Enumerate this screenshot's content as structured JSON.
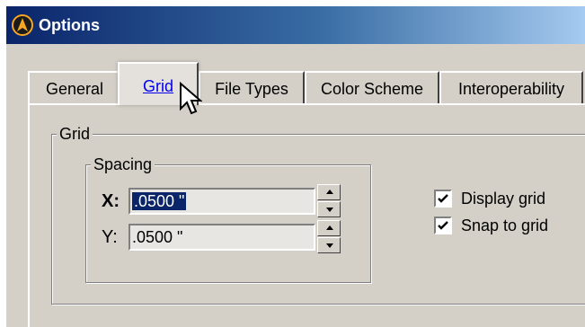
{
  "window": {
    "title": "Options"
  },
  "tabs": [
    {
      "label": "General"
    },
    {
      "label": "Grid"
    },
    {
      "label": "File Types"
    },
    {
      "label": "Color Scheme"
    },
    {
      "label": "Interoperability"
    }
  ],
  "grid_group": {
    "label": "Grid",
    "spacing_group": {
      "label": "Spacing",
      "x": {
        "label": "X:",
        "value": ".0500 \""
      },
      "y": {
        "label": "Y:",
        "value": ".0500 \""
      }
    },
    "options": [
      {
        "label": "Display grid",
        "checked": true
      },
      {
        "label": "Snap to grid",
        "checked": true
      }
    ]
  },
  "colors": {
    "title_active": "#0a246a",
    "selection": "#0a246a",
    "face": "#d4d0c8"
  },
  "icons": [
    "app-logo-icon",
    "spin-up-icon",
    "spin-down-icon",
    "checkmark-icon",
    "mouse-pointer-icon"
  ]
}
